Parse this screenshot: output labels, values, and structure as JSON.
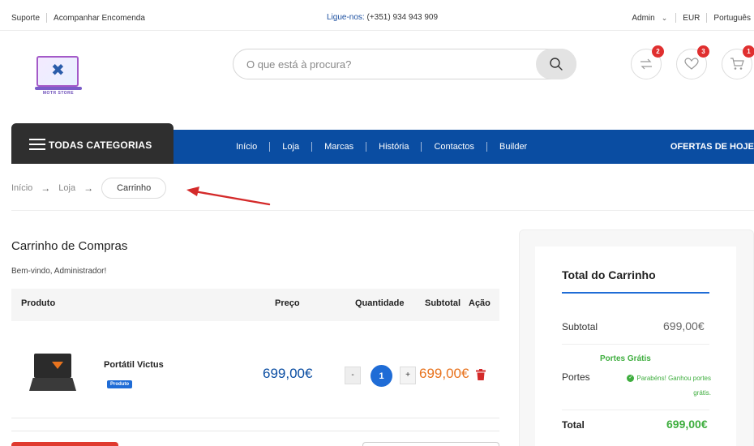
{
  "topbar": {
    "support": "Suporte",
    "track_order": "Acompanhar Encomenda",
    "call_label": "Ligue-nos:",
    "phone": "(+351) 934 943 909",
    "account": "Admin",
    "currency": "EUR",
    "language": "Português"
  },
  "header": {
    "logo_text": "MOTR STORE",
    "search_placeholder": "O que está à procura?",
    "compare_count": "2",
    "wishlist_count": "3",
    "cart_count": "1"
  },
  "nav": {
    "categories_label": "TODAS CATEGORIAS",
    "items": [
      "Início",
      "Loja",
      "Marcas",
      "História",
      "Contactos",
      "Builder"
    ],
    "offers": "OFERTAS DE HOJE"
  },
  "breadcrumb": {
    "home": "Início",
    "shop": "Loja",
    "current": "Carrinho"
  },
  "cart": {
    "title": "Carrinho de Compras",
    "welcome": "Bem-vindo, Administrador!",
    "columns": {
      "product": "Produto",
      "price": "Preço",
      "quantity": "Quantidade",
      "subtotal": "Subtotal",
      "action": "Ação"
    },
    "items": [
      {
        "name": "Portátil Victus",
        "tag": "Produto",
        "price": "699,00€",
        "qty_minus": "-",
        "quantity": "1",
        "qty_plus": "+",
        "subtotal": "699,00€"
      }
    ]
  },
  "totals": {
    "title": "Total do Carrinho",
    "subtotal_label": "Subtotal",
    "subtotal_value": "699,00€",
    "free_shipping": "Portes Grátis",
    "shipping_label": "Portes",
    "shipping_message": "Parabéns! Ganhou portes grátis.",
    "total_label": "Total",
    "total_value": "699,00€"
  },
  "colors": {
    "brand_blue": "#0a4da2",
    "accent_orange": "#e8731e",
    "success_green": "#3fae3f",
    "badge_red": "#e02f2f"
  }
}
